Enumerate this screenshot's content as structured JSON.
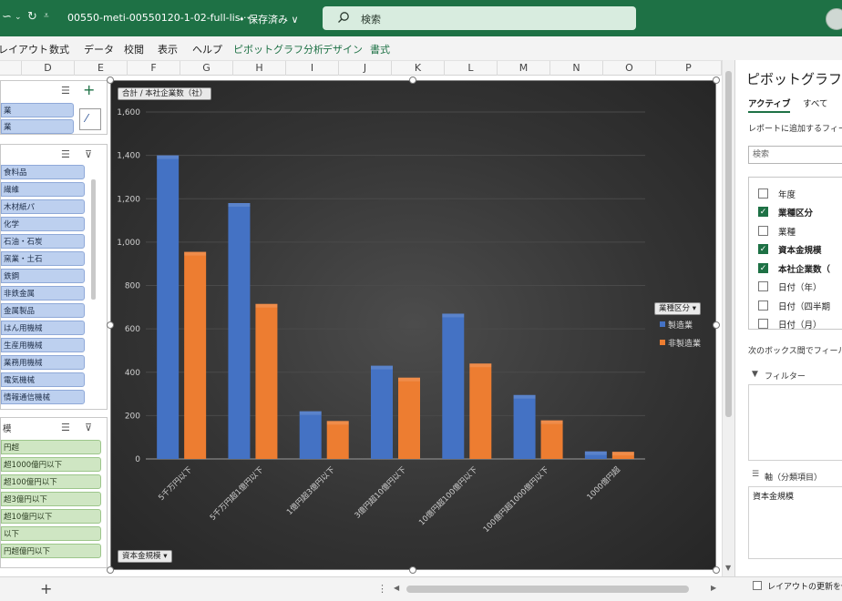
{
  "titlebar": {
    "file_name": "00550-meti-00550120-1-02-full-lis···",
    "saved_status": "• 保存済み ∨",
    "search_placeholder": "検索"
  },
  "ribbon": {
    "tabs": [
      "レイアウト",
      "数式",
      "データ",
      "校閲",
      "表示",
      "ヘルプ",
      "ピボットグラフ分析",
      "デザイン",
      "書式"
    ]
  },
  "columns": [
    "D",
    "E",
    "F",
    "G",
    "H",
    "I",
    "J",
    "K",
    "L",
    "M",
    "N",
    "O",
    "P"
  ],
  "slicer_industry": {
    "items": [
      "業",
      "業"
    ]
  },
  "slicer_sector": {
    "items": [
      "食料品",
      "繊維",
      "木材紙パ",
      "化学",
      "石油・石炭",
      "窯業・土石",
      "鉄鋼",
      "非鉄金属",
      "金属製品",
      "はん用機械",
      "生産用機械",
      "業務用機械",
      "電気機械",
      "情報通信機械"
    ]
  },
  "slicer_capital": {
    "header": "模",
    "items": [
      "円超",
      "超1000億円以下",
      "超100億円以下",
      "超3億円以下",
      "超10億円以下",
      "以下",
      "円超億円以下"
    ]
  },
  "chart_data": {
    "type": "bar",
    "title": "",
    "field_button_value": "合計 / 本社企業数（社）",
    "field_button_axis": "資本金規模",
    "field_button_legend": "業種区分",
    "categories": [
      "5千万円以下",
      "5千万円超1億円以下",
      "1億円超3億円以下",
      "3億円超10億円以下",
      "10億円超100億円以下",
      "100億円超1000億円以下",
      "1000億円超"
    ],
    "series": [
      {
        "name": "製造業",
        "color": "#4472c4",
        "values": [
          1400,
          1180,
          220,
          430,
          670,
          295,
          35
        ]
      },
      {
        "name": "非製造業",
        "color": "#ed7d31",
        "values": [
          955,
          715,
          175,
          375,
          440,
          178,
          33
        ]
      }
    ],
    "yticks": [
      "1,600",
      "1,400",
      "1,200",
      "1,000",
      "800",
      "600",
      "400",
      "200",
      "0"
    ],
    "ylim": [
      0,
      1600
    ],
    "grid": true,
    "legend_position": "right"
  },
  "pane": {
    "title": "ピボットグラフの",
    "tab_active": "アクティブ",
    "tab_all": "すべて",
    "add_fields_text": "レポートに追加するフィール",
    "search_placeholder": "検索",
    "fields": [
      {
        "label": "年度",
        "checked": false
      },
      {
        "label": "業種区分",
        "checked": true
      },
      {
        "label": "業種",
        "checked": false
      },
      {
        "label": "資本金規模",
        "checked": true
      },
      {
        "label": "本社企業数（",
        "checked": true
      },
      {
        "label": "日付（年）",
        "checked": false
      },
      {
        "label": "日付（四半期",
        "checked": false
      },
      {
        "label": "日付（月）",
        "checked": false
      }
    ],
    "drag_text": "次のボックス間でフィールド",
    "filter_label": "フィルター",
    "axis_label": "軸（分類項目）",
    "axis_value": "資本金規模",
    "defer_label": "レイアウトの更新を保"
  },
  "colors": {
    "excel_green": "#1e7145",
    "series_blue": "#4472c4",
    "series_orange": "#ed7d31"
  }
}
